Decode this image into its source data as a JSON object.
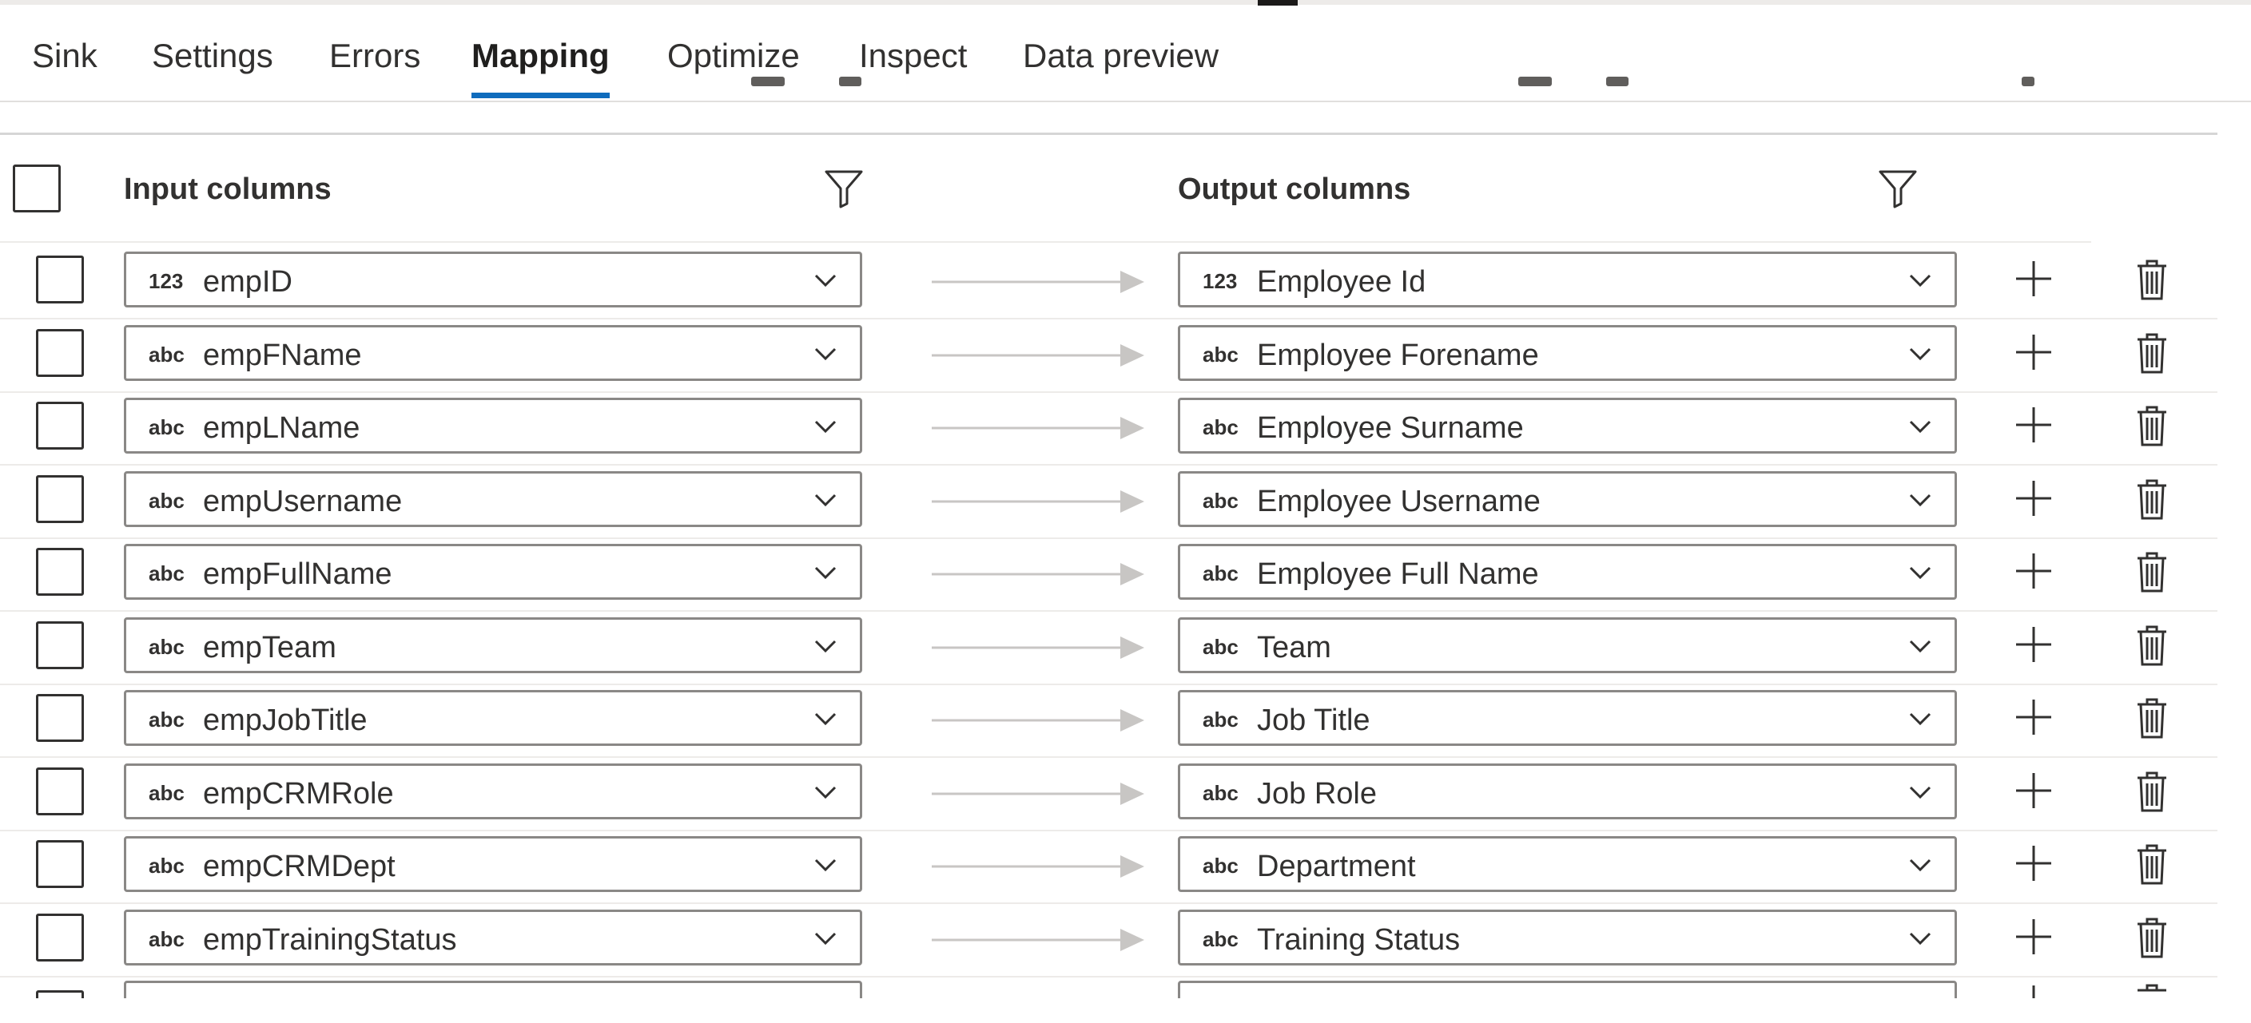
{
  "tabs": [
    {
      "label": "Sink",
      "active": false
    },
    {
      "label": "Settings",
      "active": false
    },
    {
      "label": "Errors",
      "active": false
    },
    {
      "label": "Mapping",
      "active": true
    },
    {
      "label": "Optimize",
      "active": false
    },
    {
      "label": "Inspect",
      "active": false
    },
    {
      "label": "Data preview",
      "active": false
    }
  ],
  "mapping": {
    "input_header": "Input columns",
    "output_header": "Output columns",
    "filter_icon": "funnel-filter-icon",
    "rows": [
      {
        "input_type": "123",
        "input": "empID",
        "output_type": "123",
        "output": "Employee Id"
      },
      {
        "input_type": "abc",
        "input": "empFName",
        "output_type": "abc",
        "output": "Employee Forename"
      },
      {
        "input_type": "abc",
        "input": "empLName",
        "output_type": "abc",
        "output": "Employee Surname"
      },
      {
        "input_type": "abc",
        "input": "empUsername",
        "output_type": "abc",
        "output": "Employee Username"
      },
      {
        "input_type": "abc",
        "input": "empFullName",
        "output_type": "abc",
        "output": "Employee Full Name"
      },
      {
        "input_type": "abc",
        "input": "empTeam",
        "output_type": "abc",
        "output": "Team"
      },
      {
        "input_type": "abc",
        "input": "empJobTitle",
        "output_type": "abc",
        "output": "Job Title"
      },
      {
        "input_type": "abc",
        "input": "empCRMRole",
        "output_type": "abc",
        "output": "Job Role"
      },
      {
        "input_type": "abc",
        "input": "empCRMDept",
        "output_type": "abc",
        "output": "Department"
      },
      {
        "input_type": "abc",
        "input": "empTrainingStatus",
        "output_type": "abc",
        "output": "Training Status"
      }
    ]
  },
  "icons": {
    "chevron": "chevron-down-icon",
    "arrow": "mapping-arrow-icon",
    "add": "plus-icon",
    "delete": "trash-icon"
  },
  "colors": {
    "accent": "#0f6cbd",
    "border": "#8a8886",
    "text": "#323130",
    "arrow": "#c8c6c4"
  }
}
